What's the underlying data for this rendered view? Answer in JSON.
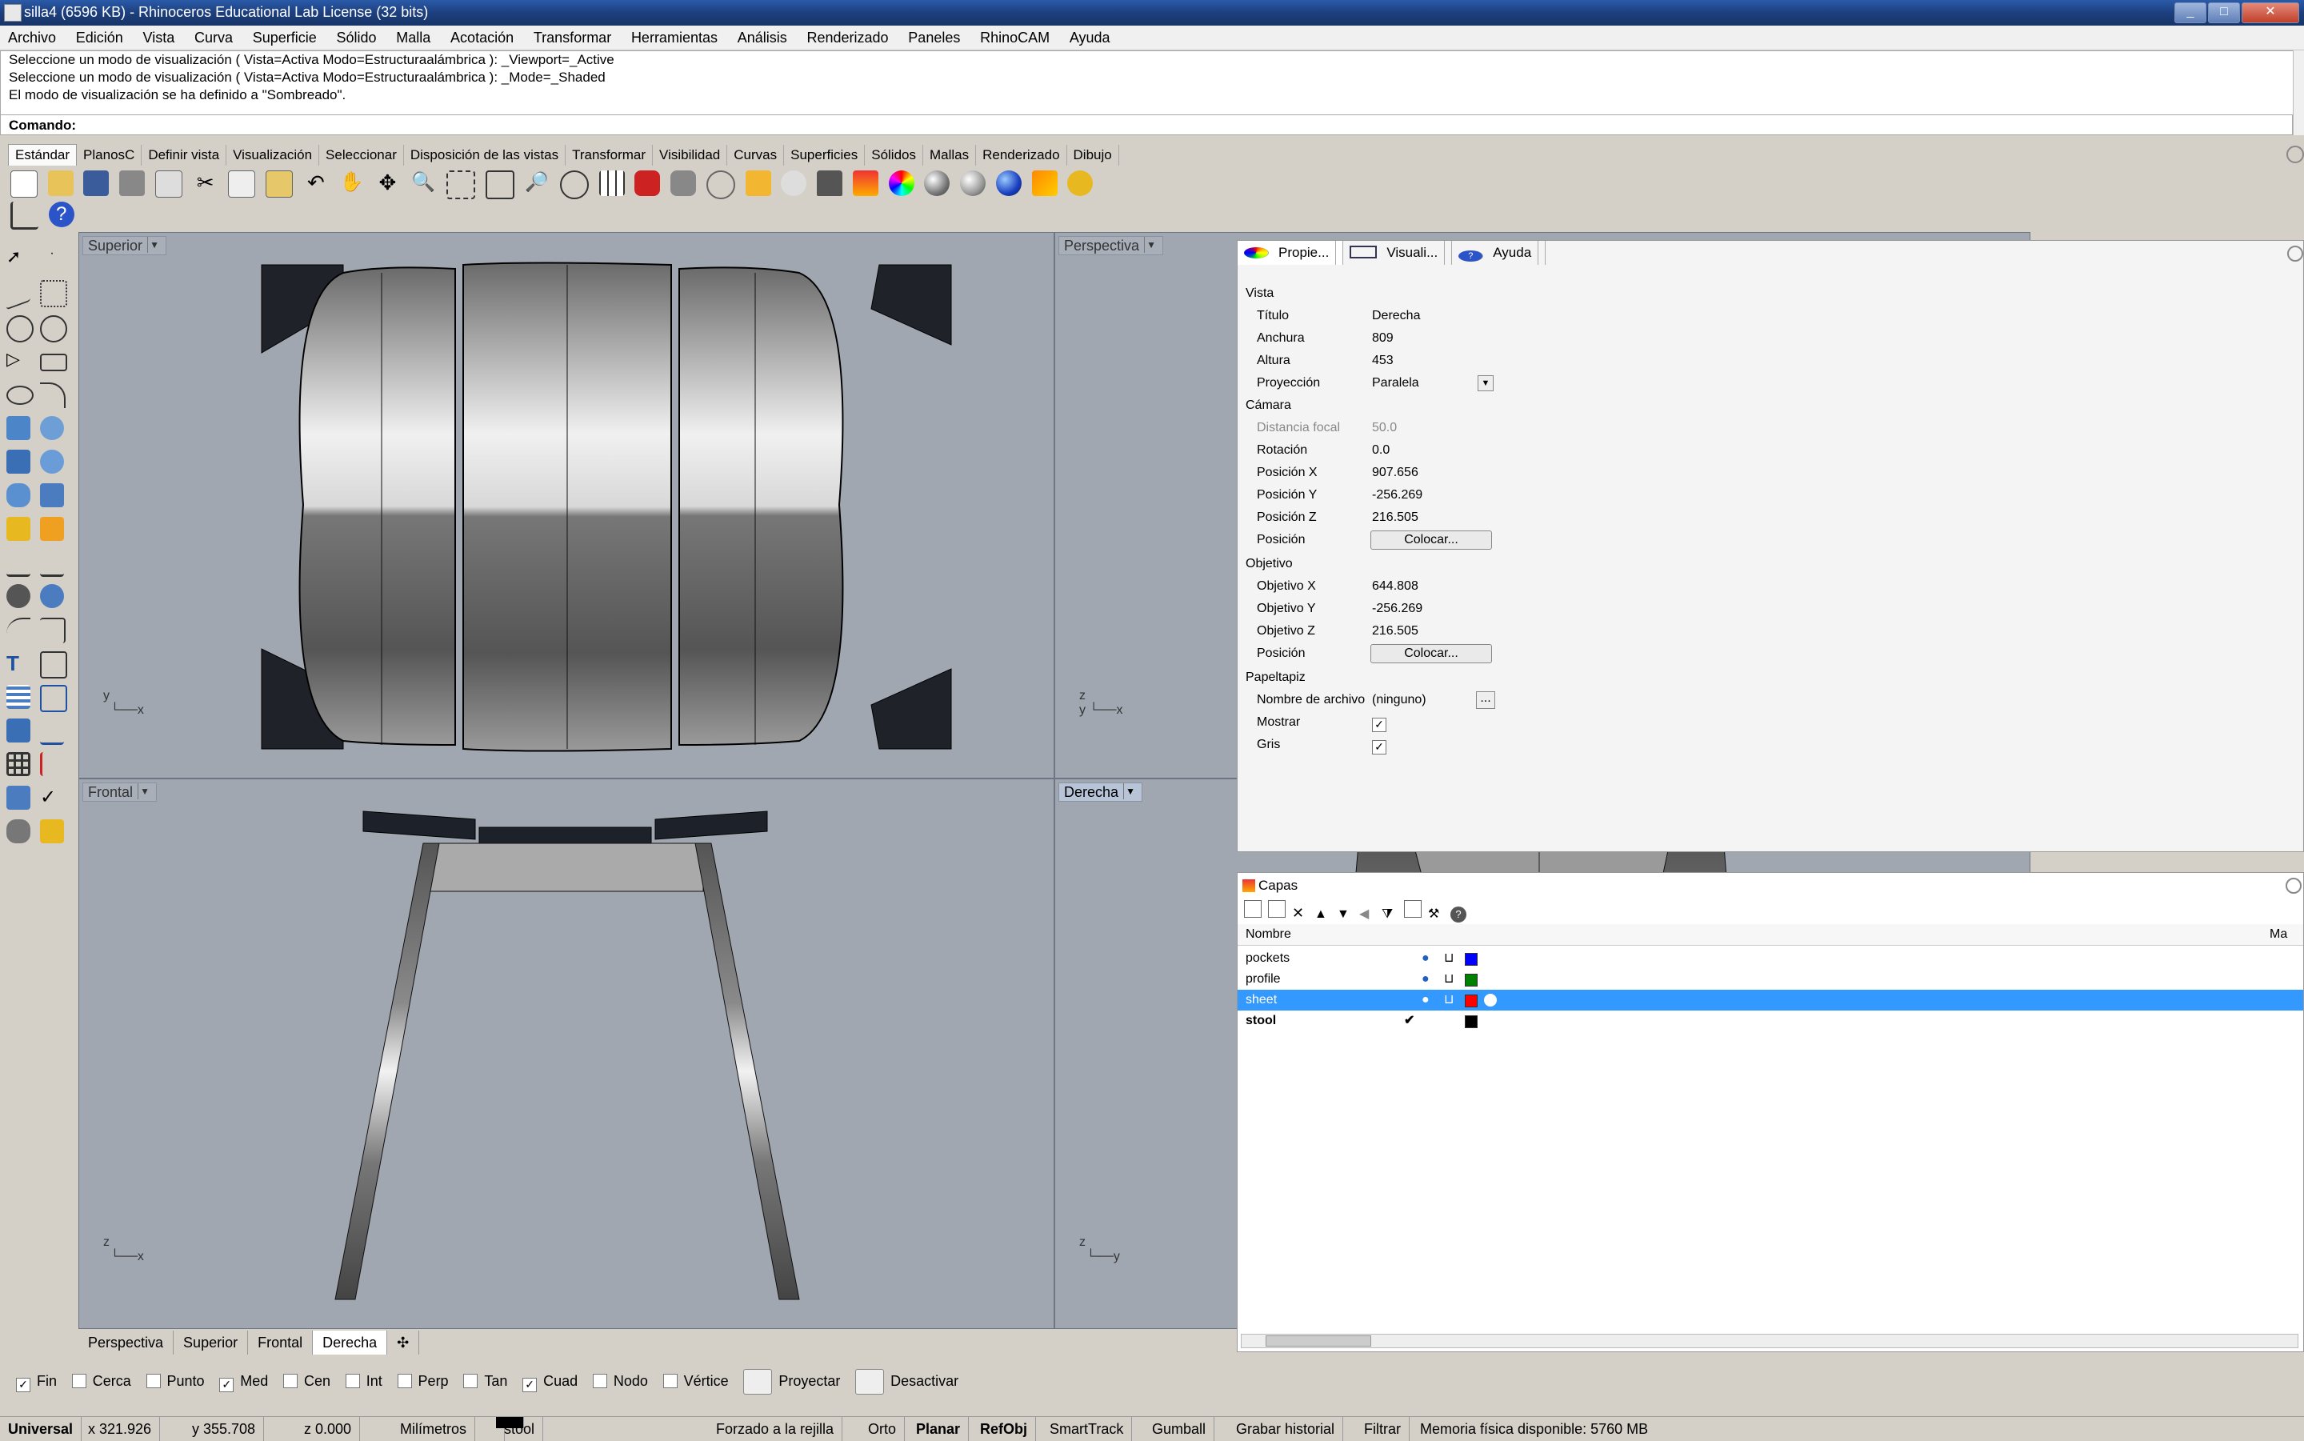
{
  "window": {
    "title": "silla4 (6596 KB) - Rhinoceros Educational Lab License (32 bits)"
  },
  "menu": [
    "Archivo",
    "Edición",
    "Vista",
    "Curva",
    "Superficie",
    "Sólido",
    "Malla",
    "Acotación",
    "Transformar",
    "Herramientas",
    "Análisis",
    "Renderizado",
    "Paneles",
    "RhinoCAM",
    "Ayuda"
  ],
  "command": {
    "history": [
      "Seleccione un modo de visualización ( Vista=Activa  Modo=Estructuraalámbrica ): _Viewport=_Active",
      "Seleccione un modo de visualización ( Vista=Activa  Modo=Estructuraalámbrica ): _Mode=_Shaded",
      "El modo de visualización se ha definido a \"Sombreado\"."
    ],
    "prompt": "Comando:"
  },
  "toolbar_tabs": [
    "Estándar",
    "PlanosC",
    "Definir vista",
    "Visualización",
    "Seleccionar",
    "Disposición de las vistas",
    "Transformar",
    "Visibilidad",
    "Curvas",
    "Superficies",
    "Sólidos",
    "Mallas",
    "Renderizado",
    "Dibujo"
  ],
  "viewports": {
    "top_left": "Superior",
    "top_right": "Perspectiva",
    "bottom_left": "Frontal",
    "bottom_right": "Derecha"
  },
  "viewport_tabs": [
    "Perspectiva",
    "Superior",
    "Frontal",
    "Derecha"
  ],
  "osnaps": [
    {
      "label": "Fin",
      "checked": true
    },
    {
      "label": "Cerca",
      "checked": false
    },
    {
      "label": "Punto",
      "checked": false
    },
    {
      "label": "Med",
      "checked": true
    },
    {
      "label": "Cen",
      "checked": false
    },
    {
      "label": "Int",
      "checked": false
    },
    {
      "label": "Perp",
      "checked": false
    },
    {
      "label": "Tan",
      "checked": false
    },
    {
      "label": "Cuad",
      "checked": true
    },
    {
      "label": "Nodo",
      "checked": false
    },
    {
      "label": "Vértice",
      "checked": false
    }
  ],
  "osnap_buttons": {
    "project": "Proyectar",
    "disable": "Desactivar"
  },
  "status": {
    "cplane": "Universal",
    "x": "x 321.926",
    "y": "y 355.708",
    "z": "z 0.000",
    "units": "Milímetros",
    "layer": "stool",
    "grid_snap": "Forzado a la rejilla",
    "ortho": "Orto",
    "planar": "Planar",
    "osnap": "RefObj",
    "smarttrack": "SmartTrack",
    "gumball": "Gumball",
    "history": "Grabar historial",
    "filter": "Filtrar",
    "memory": "Memoria física disponible: 5760 MB"
  },
  "properties": {
    "tabs": [
      "Propie...",
      "Visuali...",
      "Ayuda"
    ],
    "section_view": "Vista",
    "rows_view": [
      {
        "k": "Título",
        "v": "Derecha"
      },
      {
        "k": "Anchura",
        "v": "809"
      },
      {
        "k": "Altura",
        "v": "453"
      },
      {
        "k": "Proyección",
        "v": "Paralela"
      }
    ],
    "section_camera": "Cámara",
    "rows_camera": [
      {
        "k": "Distancia focal",
        "v": "50.0"
      },
      {
        "k": "Rotación",
        "v": "0.0"
      },
      {
        "k": "Posición X",
        "v": "907.656"
      },
      {
        "k": "Posición Y",
        "v": "-256.269"
      },
      {
        "k": "Posición Z",
        "v": "216.505"
      }
    ],
    "position_label": "Posición",
    "place_button": "Colocar...",
    "section_target": "Objetivo",
    "rows_target": [
      {
        "k": "Objetivo X",
        "v": "644.808"
      },
      {
        "k": "Objetivo Y",
        "v": "-256.269"
      },
      {
        "k": "Objetivo Z",
        "v": "216.505"
      }
    ],
    "section_wallpaper": "Papeltapiz",
    "filename_label": "Nombre de archivo",
    "filename_value": "(ninguno)",
    "show_label": "Mostrar",
    "gray_label": "Gris"
  },
  "layers": {
    "title": "Capas",
    "header_name": "Nombre",
    "header_mat": "Ma",
    "items": [
      {
        "name": "pockets",
        "color": "#0000ff"
      },
      {
        "name": "profile",
        "color": "#008000"
      },
      {
        "name": "sheet",
        "color": "#ff0000",
        "selected": true
      },
      {
        "name": "stool",
        "color": "#000000",
        "current": true
      }
    ]
  }
}
